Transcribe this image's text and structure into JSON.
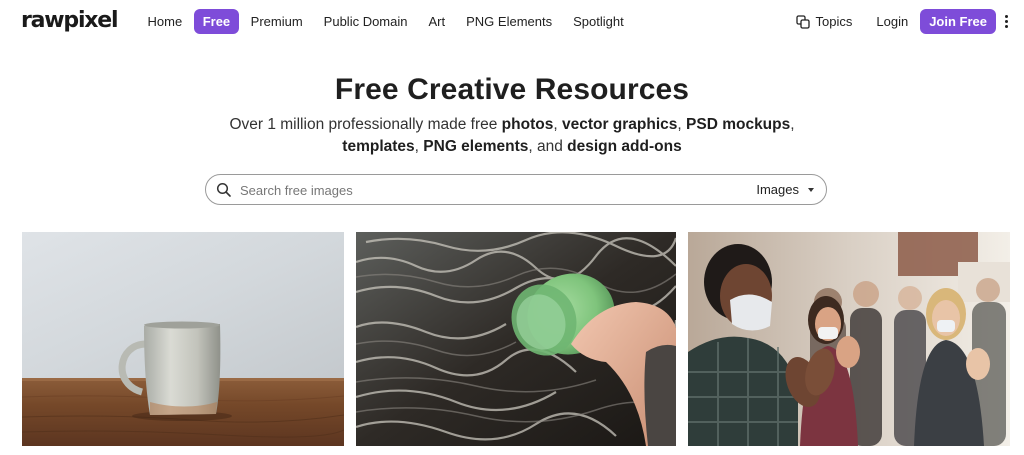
{
  "header": {
    "logo": "rawpixel",
    "nav": [
      {
        "label": "Home",
        "active": false
      },
      {
        "label": "Free",
        "active": true
      },
      {
        "label": "Premium",
        "active": false
      },
      {
        "label": "Public Domain",
        "active": false
      },
      {
        "label": "Art",
        "active": false
      },
      {
        "label": "PNG Elements",
        "active": false
      },
      {
        "label": "Spotlight",
        "active": false
      }
    ],
    "topics_label": "Topics",
    "login_label": "Login",
    "join_label": "Join Free",
    "menu_icon": "kebab-icon"
  },
  "hero": {
    "title": "Free Creative Resources",
    "subtitle_parts": [
      {
        "text": "Over 1 million professionally made free ",
        "bold": false
      },
      {
        "text": "photos",
        "bold": true
      },
      {
        "text": ", ",
        "bold": false
      },
      {
        "text": "vector graphics",
        "bold": true
      },
      {
        "text": ", ",
        "bold": false
      },
      {
        "text": "PSD mockups",
        "bold": true
      },
      {
        "text": ",",
        "bold": false
      },
      {
        "text": "templates",
        "bold": true
      },
      {
        "text": ", ",
        "bold": false
      },
      {
        "text": "PNG elements",
        "bold": true
      },
      {
        "text": ", and ",
        "bold": false
      },
      {
        "text": "design add-ons",
        "bold": true
      }
    ]
  },
  "search": {
    "placeholder": "Search free images",
    "value": "",
    "type_selected": "Images",
    "icon": "search-icon"
  },
  "photos": [
    {
      "subject": "ceramic mug on wooden table"
    },
    {
      "subject": "hand dipping green cup into water"
    },
    {
      "subject": "masked audience applauding"
    }
  ],
  "colors": {
    "accent": "#7e4cd9",
    "text": "#1f1f1f"
  }
}
